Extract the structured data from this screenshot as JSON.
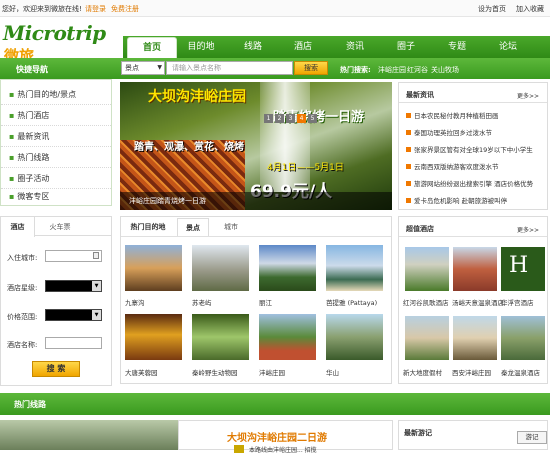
{
  "topbar": {
    "welcome": "您好，欢迎来到微旅在线!",
    "login": "请登录",
    "register": "免费注册",
    "home": "设为首页",
    "favorite": "加入收藏"
  },
  "logo": {
    "en": "Microtrip",
    "cn": "微旅"
  },
  "nav": {
    "tabs": [
      "首页",
      "目的地",
      "线路",
      "酒店",
      "资讯",
      "圈子",
      "专题",
      "论坛"
    ],
    "active": "首页"
  },
  "search": {
    "category": "景点",
    "placeholder": "请输入景点名称",
    "button": "搜索",
    "hot_label": "热门搜索:",
    "hot_keywords": [
      "沣峪庄园",
      "红河谷",
      "关山牧场"
    ]
  },
  "fast_nav": {
    "title": "快捷导航",
    "items": [
      "热门目的地/景点",
      "热门酒店",
      "最新资讯",
      "热门线路",
      "圈子活动",
      "微客专区"
    ]
  },
  "hotel_search": {
    "tabs": [
      "酒店",
      "火车票"
    ],
    "checkin_label": "入住城市:",
    "star_label": "酒店星级:",
    "price_label": "价格范围:",
    "name_label": "酒店名称:",
    "button": "搜 索"
  },
  "banner": {
    "title": "大坝沟沣峪庄园",
    "subtitle": "踏青烧烤一日游",
    "line": "踏青、观瀑、赏花、烧烤",
    "date": "4月1日——5月1日",
    "price": "69.9元/人",
    "caption": "沣峪庄园踏青烧烤一日游",
    "dots": [
      "1",
      "2",
      "3",
      "4",
      "5"
    ],
    "active_dot": "4"
  },
  "news": {
    "title": "最新资讯",
    "more": "更多>>",
    "items": [
      "日本农民秘付教月种植稻田画",
      "泰国功理英拉回乡过泼水节",
      "张家界景区管有对全球19岁以下中小学生",
      "云南西双版纳游客欢度泼水节",
      "旅游网站纷纷退出搜索引擎 酒店价格优势",
      "爱卡岛危机影响 赴朝旅游被叫停"
    ]
  },
  "dest": {
    "tabs": [
      "热门目的地",
      "景点",
      "城市"
    ],
    "active": "景点",
    "items": [
      "九寨沟",
      "苏老屿",
      "丽江",
      "芭提雅 (Pattaya)",
      "大唐芙蓉园",
      "秦岭野生动物园",
      "沣峪庄园",
      "华山"
    ]
  },
  "hotels": {
    "title": "超值酒店",
    "more": "更多>>",
    "items": [
      "红河谷凯歌酒店",
      "汤峪天意温泉酒店",
      "华浮宫酒店",
      "新大地度假村",
      "西安沣峪庄园",
      "秦龙温泉酒店"
    ]
  },
  "bottom": {
    "hot_route": "热门线路",
    "route_title": "大坝沟沣峪庄园二日游",
    "route_sub": "本路线由沣峪庄园... 招揽",
    "new_travel": "最新游记",
    "write_btn": "游记"
  },
  "colors": {
    "green": "#3a9a1f",
    "orange": "#f07800",
    "yellow": "#ffe600"
  }
}
